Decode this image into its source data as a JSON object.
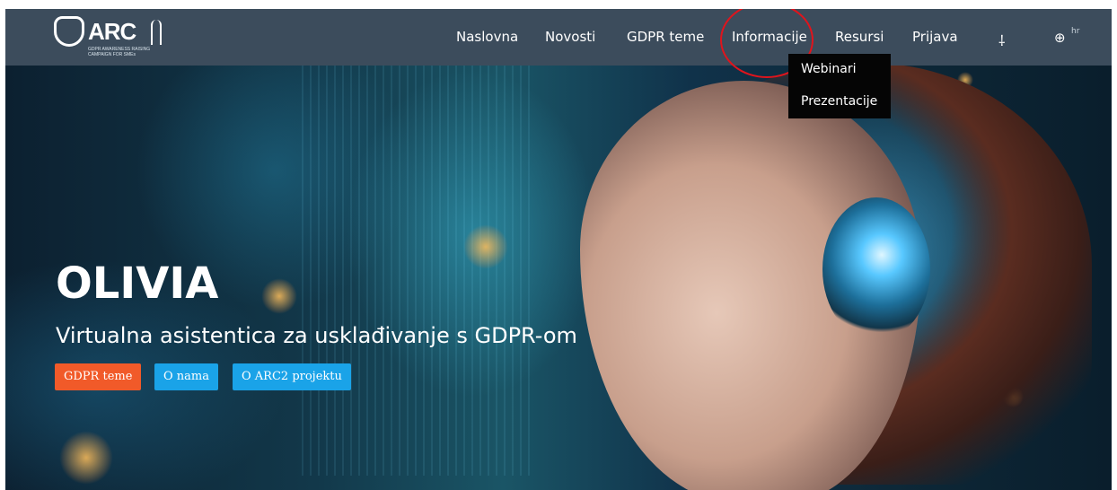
{
  "logo": {
    "text": "ARC",
    "subtitle": "GDPR AWARENESS RAISING CAMPAIGN FOR SMEs"
  },
  "nav": {
    "items": [
      "Naslovna",
      "Novosti",
      "GDPR teme",
      "Informacije",
      "Resursi",
      "Prijava"
    ],
    "accessibility_icon": "accessibility-icon",
    "language_icon": "globe-icon",
    "language_code": "hr",
    "active_highlight": "Informacije"
  },
  "dropdown": {
    "items": [
      "Webinari",
      "Prezentacije"
    ]
  },
  "hero": {
    "title": "OLIVIA",
    "subtitle": "Virtualna asistentica za usklađivanje s GDPR-om",
    "buttons": [
      "GDPR teme",
      "O nama",
      "O ARC2 projektu"
    ]
  },
  "colors": {
    "navbar": "#3c4c5c",
    "button_orange": "#f15a29",
    "button_blue": "#1aa3e8",
    "highlight_ring": "#e0141c",
    "dropdown_bg": "#050505"
  }
}
